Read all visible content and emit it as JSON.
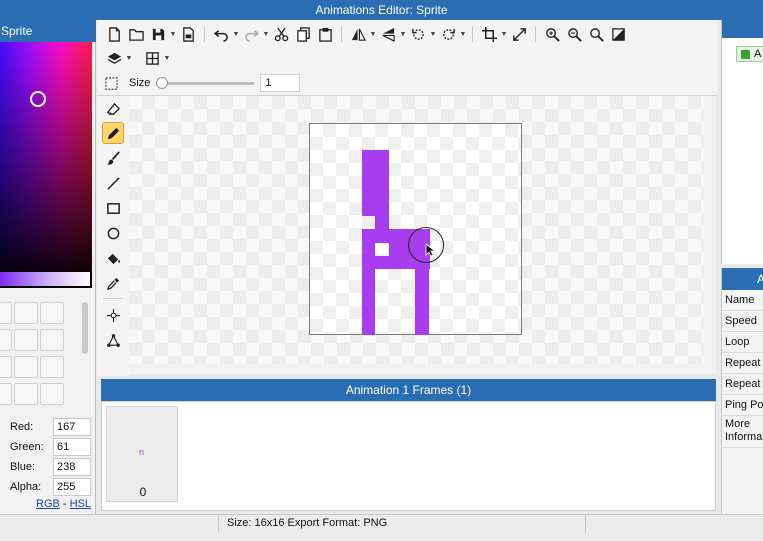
{
  "window": {
    "title": "Animations Editor: Sprite"
  },
  "left_panel": {
    "header": "Sprite",
    "color": {
      "red": "167",
      "green": "61",
      "blue": "238",
      "alpha": "255"
    },
    "labels": {
      "red": "Red:",
      "green": "Green:",
      "blue": "Blue:",
      "alpha": "Alpha:"
    },
    "modes": {
      "rgb": "RGB",
      "sep": " - ",
      "hsl": "HSL"
    }
  },
  "toolbar": {
    "row1_icons": [
      "new-file-icon",
      "open-folder-icon",
      "save-icon",
      "save-as-icon",
      "undo-icon",
      "redo-icon",
      "cut-icon",
      "copy-icon",
      "paste-icon",
      "flip-horizontal-icon",
      "flip-vertical-icon",
      "rotate-left-icon",
      "rotate-right-icon",
      "crop-icon",
      "resize-icon",
      "zoom-fit-icon",
      "zoom-out-icon",
      "zoom-in-icon",
      "fill-background-icon"
    ],
    "row2_icons": [
      "layers-icon",
      "grid-icon"
    ],
    "size_label": "Size",
    "size_value": "1"
  },
  "side_tools": [
    "select-icon",
    "eraser-icon",
    "pencil-icon",
    "brush-icon",
    "line-icon",
    "rectangle-icon",
    "ellipse-icon",
    "fill-bucket-icon",
    "eyedropper-icon",
    "move-point-icon",
    "polygon-icon"
  ],
  "accent_color": "#a73dee",
  "frames": {
    "header": "Animation 1 Frames (1)",
    "items": [
      {
        "index": "0",
        "preview": "n"
      }
    ]
  },
  "right_panel": {
    "layer_label": "A",
    "header": "A",
    "properties": [
      "Name",
      "Speed",
      "Loop",
      "Repeat C",
      "Repeat",
      "Ping Po",
      "More Informa"
    ]
  },
  "status": {
    "text": "Size: 16x16   Export Format: PNG"
  }
}
